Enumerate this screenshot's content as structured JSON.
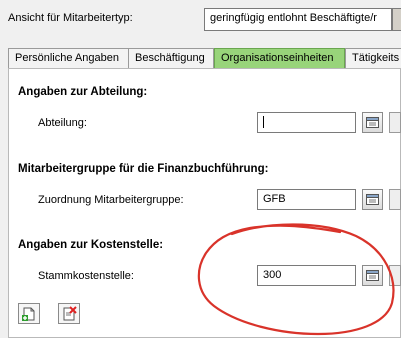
{
  "header": {
    "view_label": "Ansicht für Mitarbeitertyp:",
    "view_value": "geringfügig entlohnt Beschäftigte/r"
  },
  "tabs": [
    {
      "label": "Persönliche Angaben"
    },
    {
      "label": "Beschäftigung"
    },
    {
      "label": "Organisationseinheiten"
    },
    {
      "label": "Tätigkeits"
    }
  ],
  "sections": {
    "department": {
      "title": "Angaben zur Abteilung:",
      "field_label": "Abteilung:",
      "field_value": ""
    },
    "employee_group": {
      "title": "Mitarbeitergruppe für die Finanzbuchführung:",
      "field_label": "Zuordnung Mitarbeitergruppe:",
      "field_value": "GFB"
    },
    "cost_center": {
      "title": "Angaben zur Kostenstelle:",
      "field_label": "Stammkostenstelle:",
      "field_value": "300"
    }
  },
  "colors": {
    "active_tab": "#98d47a",
    "annotation": "#d9332a"
  },
  "icons": {
    "picker": "list-picker-icon",
    "new": "new-document-icon",
    "delete": "delete-document-icon"
  }
}
